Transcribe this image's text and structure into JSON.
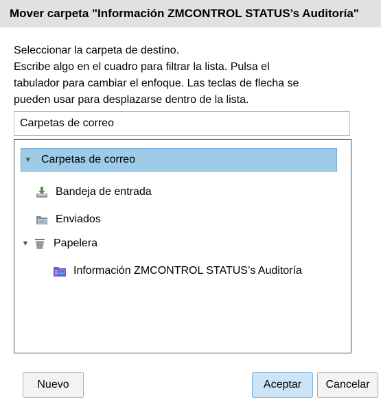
{
  "dialog": {
    "title": "Mover carpeta \"Información ZMCONTROL STATUS’s Auditoría\"",
    "instructions": [
      "Seleccionar la carpeta de destino.",
      "Escribe algo en el cuadro para filtrar la lista. Pulsa el",
      "tabulador para cambiar el enfoque. Las teclas de flecha se",
      "pueden usar para desplazarse dentro de la lista."
    ],
    "filter_value": "Carpetas de correo"
  },
  "tree": {
    "root": {
      "label": "Carpetas de correo",
      "expanded": true,
      "selected": true
    },
    "items": [
      {
        "label": "Bandeja de entrada",
        "icon": "inbox-download-icon"
      },
      {
        "label": "Enviados",
        "icon": "sent-folder-icon"
      },
      {
        "label": "Papelera",
        "icon": "trash-icon",
        "expanded": true
      },
      {
        "label": "Información ZMCONTROL STATUS’s Auditoría",
        "icon": "shared-folder-icon"
      }
    ]
  },
  "buttons": {
    "new": "Nuevo",
    "accept": "Aceptar",
    "cancel": "Cancelar"
  },
  "colors": {
    "selection": "#9ecbe8",
    "primary_button": "#cde3f6",
    "titlebar": "#e1e1e1"
  }
}
